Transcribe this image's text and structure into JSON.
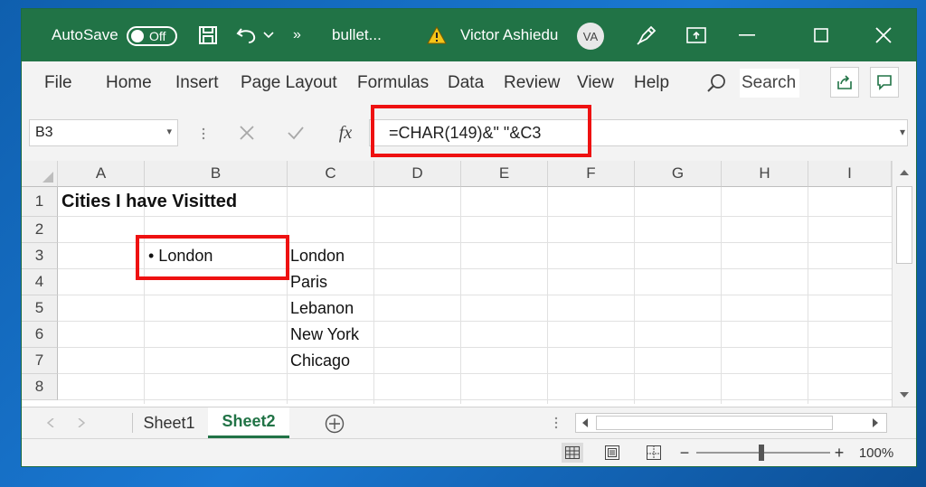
{
  "titlebar": {
    "autosave_label": "AutoSave",
    "autosave_state": "Off",
    "filename": "bullet...",
    "user_name": "Victor Ashiedu",
    "user_initials": "VA",
    "more_label": "»"
  },
  "menu": {
    "items": [
      "File",
      "Home",
      "Insert",
      "Page Layout",
      "Formulas",
      "Data",
      "Review",
      "View",
      "Help"
    ],
    "search": "Search"
  },
  "formula_bar": {
    "name_box": "B3",
    "formula": "=CHAR(149)&\" \"&C3",
    "fx": "fx"
  },
  "grid": {
    "columns": [
      "A",
      "B",
      "C",
      "D",
      "E",
      "F",
      "G",
      "H",
      "I"
    ],
    "rows": [
      "1",
      "2",
      "3",
      "4",
      "5",
      "6",
      "7",
      "8"
    ],
    "cells": {
      "A1": "Cities I have Visitted",
      "B3": "• London",
      "C3": "London",
      "C4": "Paris",
      "C5": "Lebanon",
      "C6": "New York",
      "C7": "Chicago"
    }
  },
  "sheets": {
    "tabs": [
      "Sheet1",
      "Sheet2"
    ],
    "active": "Sheet2"
  },
  "status": {
    "zoom": "100%",
    "zoom_minus": "−",
    "zoom_plus": "+"
  },
  "colors": {
    "excel_green": "#217346",
    "highlight_red": "#e11111"
  }
}
